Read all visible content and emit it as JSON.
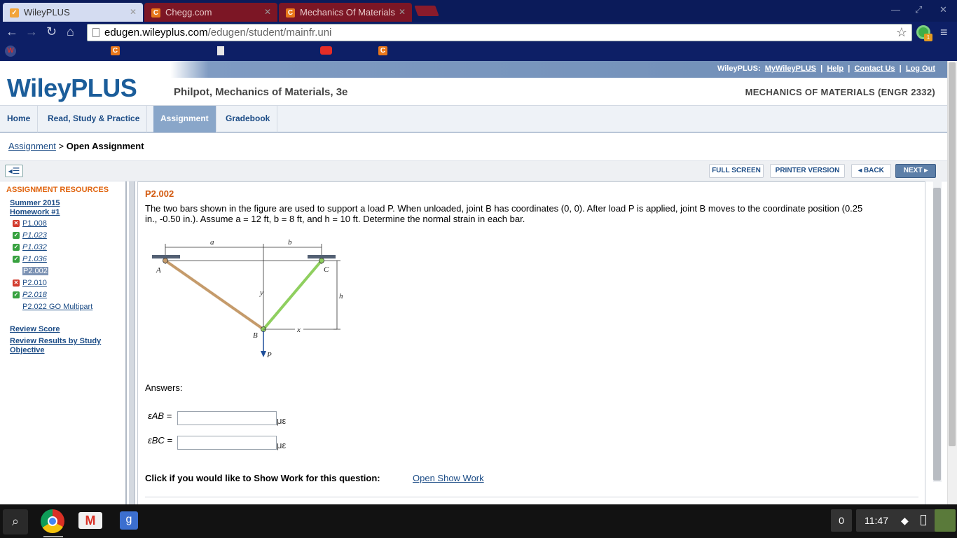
{
  "browser": {
    "tabs": [
      {
        "title": "WileyPLUS",
        "active": true
      },
      {
        "title": "Chegg.com",
        "active": false
      },
      {
        "title": "Mechanics Of Materials",
        "active": false
      }
    ],
    "url_host": "edugen.wileyplus.com",
    "url_path": "/edugen/student/mainfr.uni",
    "extension_badge": "1"
  },
  "site": {
    "top_links_prefix": "WileyPLUS:",
    "top_links": [
      "MyWileyPLUS",
      "Help",
      "Contact Us",
      "Log Out"
    ],
    "logo": "WileyPLUS",
    "book_title": "Philpot, Mechanics of Materials, 3e",
    "course": "MECHANICS OF MATERIALS (ENGR 2332)",
    "nav": [
      "Home",
      "Read, Study & Practice",
      "Assignment",
      "Gradebook"
    ],
    "nav_active": "Assignment"
  },
  "breadcrumb": {
    "link": "Assignment",
    "sep": ">",
    "current": "Open Assignment"
  },
  "toolbar": {
    "full_screen": "FULL SCREEN",
    "printer": "PRINTER VERSION",
    "back": "◂ BACK",
    "next": "NEXT ▸"
  },
  "sidebar": {
    "title": "ASSIGNMENT RESOURCES",
    "homework_line1": "Summer 2015",
    "homework_line2": "Homework #1",
    "questions": [
      {
        "id": "P1.008",
        "status": "incorrect",
        "italic": false
      },
      {
        "id": "P1.023",
        "status": "correct",
        "italic": true
      },
      {
        "id": "P1.032",
        "status": "correct",
        "italic": true
      },
      {
        "id": "P1.036",
        "status": "correct",
        "italic": true
      },
      {
        "id": "P2.002",
        "status": "current",
        "italic": false
      },
      {
        "id": "P2.010",
        "status": "incorrect",
        "italic": false
      },
      {
        "id": "P2.018",
        "status": "correct",
        "italic": true
      },
      {
        "id": "P2.022 GO Multipart",
        "status": "none",
        "italic": false
      }
    ],
    "review_score": "Review Score",
    "review_results_1": "Review Results by Study",
    "review_results_2": "Objective"
  },
  "question": {
    "id": "P2.002",
    "text_line1": "The two bars shown in the figure are used to support a load P. When unloaded, joint B has coordinates (0, 0). After load P is applied, joint B moves to the coordinate position (0.25",
    "text_line2": "in., -0.50 in.). Assume a = 12 ft, b = 8 ft, and h = 10 ft. Determine the normal strain in each bar.",
    "figure_labels": {
      "a": "a",
      "b": "b",
      "A": "A",
      "C": "C",
      "y": "y",
      "h": "h",
      "x": "x",
      "B": "B",
      "P": "P"
    },
    "answers_label": "Answers:",
    "eps_ab": "εAB =",
    "eps_bc": "εBC =",
    "unit": "με",
    "answer_ab_value": "",
    "answer_bc_value": "",
    "show_work_prompt": "Click if you would like to Show Work for this question:",
    "show_work_link": "Open Show Work"
  },
  "shelf": {
    "notification_count": "0",
    "time": "11:47"
  }
}
